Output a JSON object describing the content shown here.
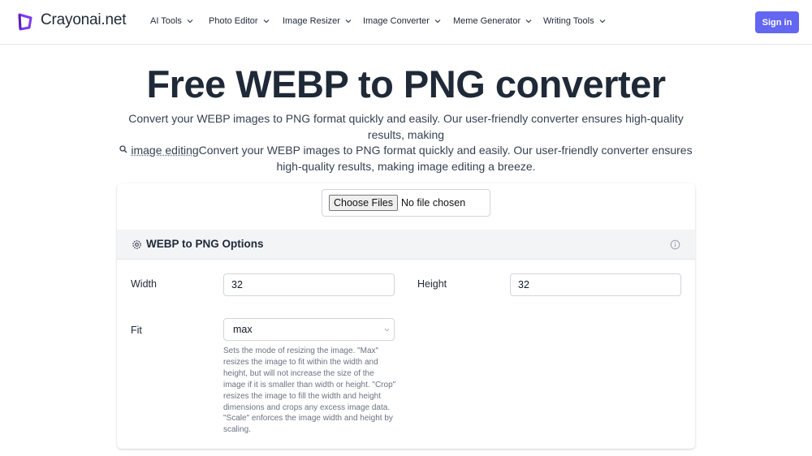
{
  "brand": {
    "name": "Crayonai.net",
    "logo_icon": "crayon-frame-logo",
    "accent": "#6366f1",
    "logo_color": "#7c3aed"
  },
  "nav": {
    "items": [
      {
        "label": "AI Tools",
        "icon": "chevron-down-icon"
      },
      {
        "label": "Photo Editor",
        "icon": "chevron-down-icon"
      },
      {
        "label": "Image Resizer",
        "icon": "chevron-down-icon"
      },
      {
        "label": "Image Converter",
        "icon": "chevron-down-icon"
      },
      {
        "label": "Meme Generator",
        "icon": "chevron-down-icon"
      },
      {
        "label": "Writing Tools",
        "icon": "chevron-down-icon"
      }
    ],
    "sign_in": "Sign in"
  },
  "hero": {
    "title": "Free WEBP to PNG converter",
    "desc_line1": "Convert your WEBP images to PNG format quickly and easily. Our user-friendly converter ensures high-quality results, making",
    "desc_term": "image editing",
    "desc_rest": "Convert your WEBP images to PNG format quickly and easily. Our user-friendly converter ensures high-quality results, making image editing a breeze."
  },
  "upload": {
    "button": "Choose Files",
    "status": "No file chosen"
  },
  "options": {
    "title": "WEBP to PNG Options",
    "width_label": "Width",
    "width_value": "32",
    "height_label": "Height",
    "height_value": "32",
    "fit_label": "Fit",
    "fit_value": "max",
    "fit_help": "Sets the mode of resizing the image. \"Max\" resizes the image to fit within the width and height, but will not increase the size of the image if it is smaller than width or height. \"Crop\" resizes the image to fill the width and height dimensions and crops any excess image data. \"Scale\" enforces the image width and height by scaling."
  }
}
